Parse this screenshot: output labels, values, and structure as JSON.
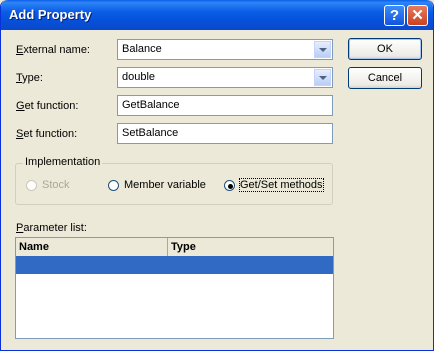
{
  "window": {
    "title": "Add Property"
  },
  "titlebar": {
    "help_glyph": "?",
    "close_glyph": "✕",
    "help_icon": "question-icon",
    "close_icon": "close-icon"
  },
  "form": {
    "external_name": {
      "label_key": "E",
      "label_rest": "xternal name:",
      "value": "Balance"
    },
    "type": {
      "label_key": "T",
      "label_rest": "ype:",
      "value": "double"
    },
    "get_function": {
      "label_key": "G",
      "label_rest": "et function:",
      "value": "GetBalance"
    },
    "set_function": {
      "label_key": "S",
      "label_rest": "et function:",
      "value": "SetBalance"
    }
  },
  "buttons": {
    "ok": "OK",
    "cancel": "Cancel"
  },
  "implementation": {
    "title": "Implementation",
    "options": [
      {
        "label": "Stock",
        "selected": false,
        "enabled": false
      },
      {
        "label": "Member variable",
        "selected": false,
        "enabled": true
      },
      {
        "label": "Get/Set methods",
        "selected": true,
        "enabled": true
      }
    ]
  },
  "parameters": {
    "label_key": "P",
    "label_rest": "arameter list:",
    "columns": [
      "Name",
      "Type"
    ]
  },
  "colors": {
    "title_bar": "#0A5DE6",
    "selection": "#316AC5",
    "dialog_bg": "#ECE9D8"
  }
}
